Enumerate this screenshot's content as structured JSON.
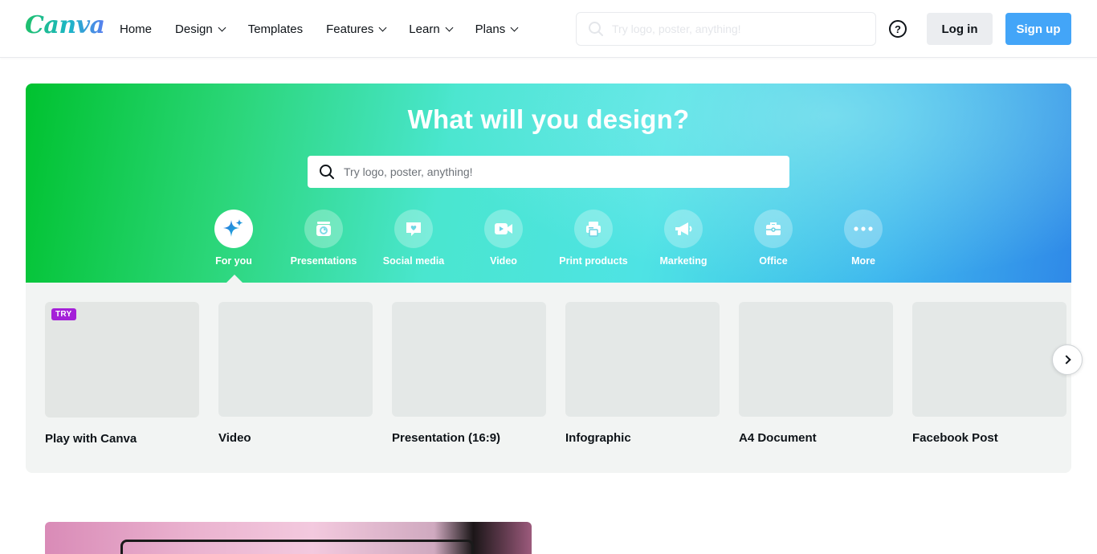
{
  "nav": {
    "logo": "Canva",
    "items": [
      {
        "label": "Home",
        "dropdown": false
      },
      {
        "label": "Design",
        "dropdown": true
      },
      {
        "label": "Templates",
        "dropdown": false
      },
      {
        "label": "Features",
        "dropdown": true
      },
      {
        "label": "Learn",
        "dropdown": true
      },
      {
        "label": "Plans",
        "dropdown": true
      }
    ],
    "search_placeholder": "Try logo, poster, anything!",
    "help_symbol": "?",
    "login_label": "Log in",
    "signup_label": "Sign up"
  },
  "hero": {
    "title": "What will you design?",
    "search_placeholder": "Try logo, poster, anything!",
    "categories": [
      {
        "label": "For you",
        "icon": "sparkle-icon",
        "active": true
      },
      {
        "label": "Presentations",
        "icon": "presentation-icon",
        "active": false
      },
      {
        "label": "Social media",
        "icon": "heart-chat-icon",
        "active": false
      },
      {
        "label": "Video",
        "icon": "video-camera-icon",
        "active": false
      },
      {
        "label": "Print products",
        "icon": "printer-icon",
        "active": false
      },
      {
        "label": "Marketing",
        "icon": "megaphone-icon",
        "active": false
      },
      {
        "label": "Office",
        "icon": "briefcase-icon",
        "active": false
      },
      {
        "label": "More",
        "icon": "more-dots-icon",
        "active": false
      }
    ]
  },
  "templates": {
    "items": [
      {
        "label": "Play with Canva",
        "badge": "TRY"
      },
      {
        "label": "Video"
      },
      {
        "label": "Presentation (16:9)"
      },
      {
        "label": "Infographic"
      },
      {
        "label": "A4 Document"
      },
      {
        "label": "Facebook Post"
      }
    ]
  },
  "colors": {
    "accent_blue": "#43a5f8",
    "try_badge": "#a420d8",
    "hero_green": "#00c22f",
    "hero_blue": "#2f89e8"
  }
}
